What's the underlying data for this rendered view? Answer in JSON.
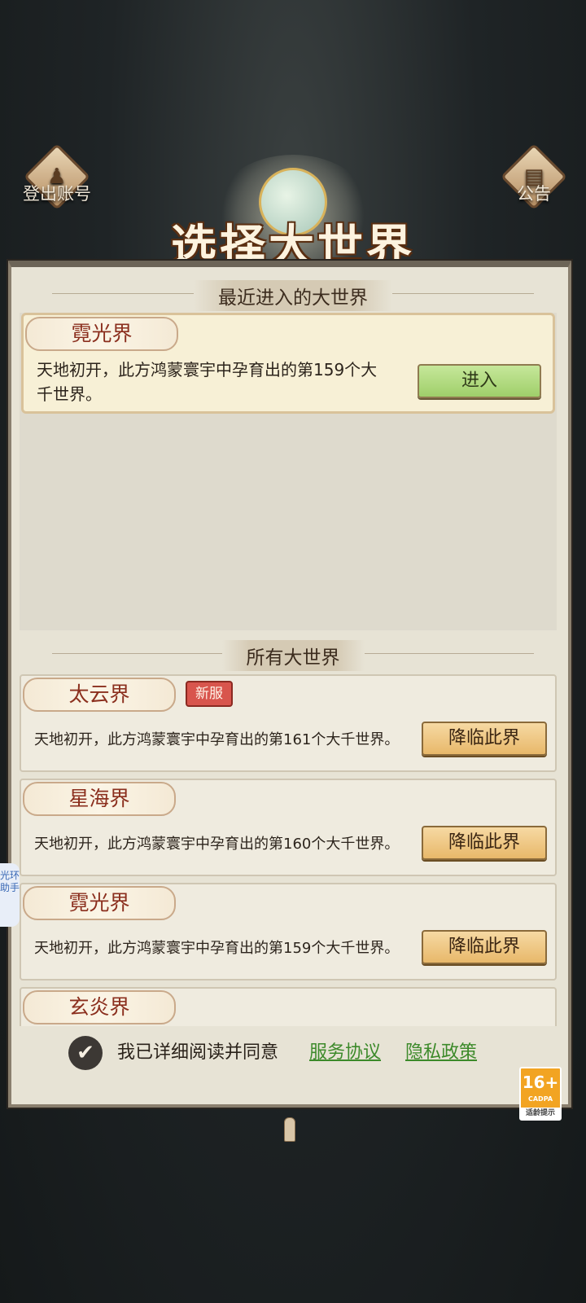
{
  "header": {
    "logout_label": "登出账号",
    "notice_label": "公告",
    "title": "选择大世界"
  },
  "recent": {
    "section_title": "最近进入的大世界",
    "world": {
      "name": "霓光界",
      "desc_line1": "天地初开，此方鸿蒙寰宇中孕育出的第159个大",
      "desc_line2": "千世界。",
      "enter_label": "进入"
    }
  },
  "all": {
    "section_title": "所有大世界",
    "worlds": [
      {
        "name": "太云界",
        "badge": "新服",
        "desc": "天地初开，此方鸿蒙寰宇中孕育出的第161个大千世界。",
        "button": "降临此界"
      },
      {
        "name": "星海界",
        "desc": "天地初开，此方鸿蒙寰宇中孕育出的第160个大千世界。",
        "button": "降临此界"
      },
      {
        "name": "霓光界",
        "desc": "天地初开，此方鸿蒙寰宇中孕育出的第159个大千世界。",
        "button": "降临此界"
      },
      {
        "name": "玄炎界"
      }
    ]
  },
  "agreement": {
    "text": "我已详细阅读并同意",
    "service_link": "服务协议",
    "privacy_link": "隐私政策",
    "checked_glyph": "✔"
  },
  "age_badge": {
    "rating": "16+",
    "org": "CADPA",
    "label": "适龄提示"
  },
  "side_helper": {
    "label": "光环助手"
  },
  "icons": {
    "logout": "person-icon",
    "notice": "scroll-icon"
  },
  "colors": {
    "enter_button": "#b2dc7e",
    "descend_button": "#efc985",
    "new_badge": "#d8554d",
    "link": "#3c8a2a"
  }
}
